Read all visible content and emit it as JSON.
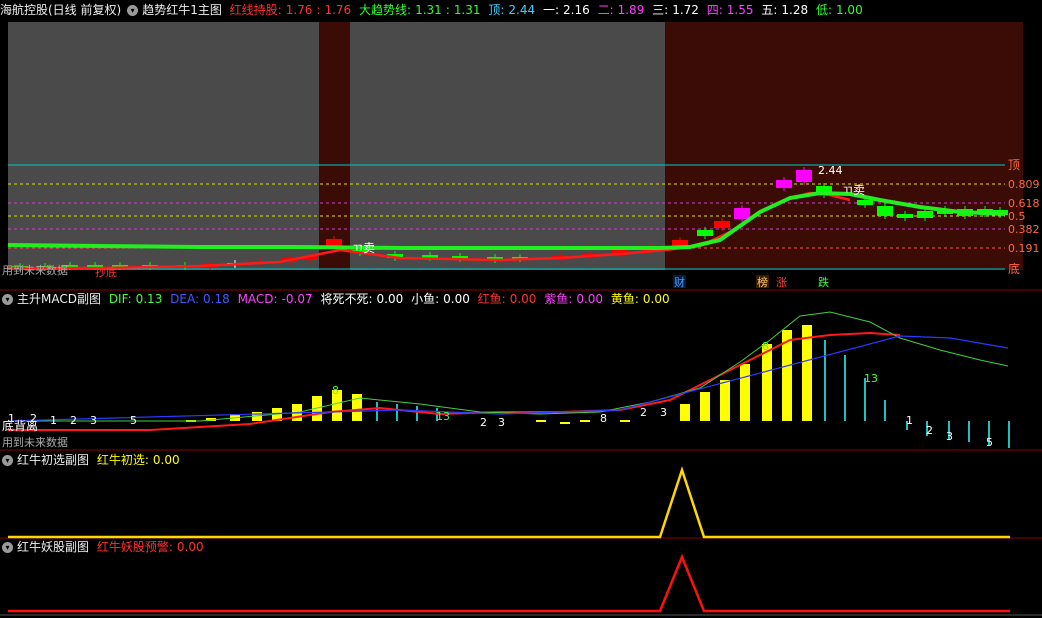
{
  "header_main": {
    "stock": "海航控股(日线 前复权)",
    "indicator": "趋势红牛1主图",
    "red_label": "红线持股:",
    "red_v1": "1.76",
    "red_v2": "1.76",
    "big_label": "大趋势线:",
    "big_v1": "1.31",
    "big_v2": "1.31",
    "top_label": "顶:",
    "top_v": "2.44",
    "l1_label": "一:",
    "l1_v": "2.16",
    "l2_label": "二:",
    "l2_v": "1.89",
    "l3_label": "三:",
    "l3_v": "1.72",
    "l4_label": "四:",
    "l4_v": "1.55",
    "l5_label": "五:",
    "l5_v": "1.28",
    "low_label": "低:",
    "low_v": "1.00"
  },
  "header_macd": {
    "title": "主升MACD副图",
    "dif_label": "DIF:",
    "dif_v": "0.13",
    "dea_label": "DEA:",
    "dea_v": "0.18",
    "macd_label": "MACD:",
    "macd_v": "-0.07",
    "jiang_label": "将死不死:",
    "jiang_v": "0.00",
    "xiao_label": "小鱼:",
    "xiao_v": "0.00",
    "hong_label": "红鱼:",
    "hong_v": "0.00",
    "zi_label": "紫鱼:",
    "zi_v": "0.00",
    "huang_label": "黄鱼:",
    "huang_v": "0.00"
  },
  "header_chuxuan": {
    "title": "红牛初选副图",
    "label": "红牛初选:",
    "value": "0.00"
  },
  "header_yao": {
    "title": "红牛妖股副图",
    "label": "红牛妖股预警:",
    "value": "0.00"
  },
  "right_labels": {
    "top": "顶",
    "r0809": "0.809",
    "r0618": "0.618",
    "r05": "0.5",
    "r0382": "0.382",
    "r0191": "0.191",
    "bottom": "底"
  },
  "annotations": {
    "peak": "2.44",
    "fast_sell_1": "卖",
    "fast_sell_2": "卖",
    "future_data_main": "用到未来数据",
    "future_data_macd": "用到未来数据",
    "bottom_div": "底背离",
    "cai": "财",
    "bang": "榜",
    "zhang": "涨",
    "die": "跌",
    "chaodi": "抄底"
  },
  "colors": {
    "background": "#000000",
    "gray_zone": "#4a4a4a",
    "red_zone": "#3b0b05",
    "up_candle": "#ff0000",
    "down_candle": "#00ff00",
    "magenta": "#ff00ff",
    "yellow": "#ffff00",
    "cyan": "#00c0c0"
  }
}
